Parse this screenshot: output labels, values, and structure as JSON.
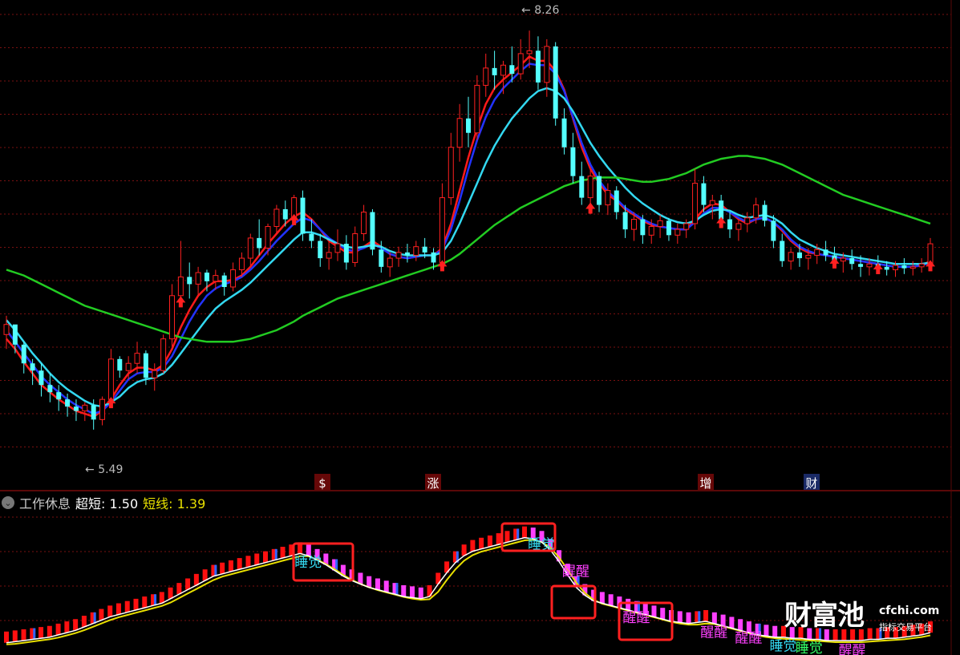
{
  "chart_data": [
    {
      "type": "candlestick",
      "title": "",
      "price_range": [
        5.2,
        8.45
      ],
      "grid": true,
      "annotations": {
        "high_label": "8.26",
        "low_label": "5.49"
      },
      "markers": [
        "$",
        "涨",
        "增",
        "财"
      ],
      "candles": [
        [
          6.15,
          6.28,
          6.05,
          6.22
        ],
        [
          6.22,
          6.2,
          6.02,
          6.08
        ],
        [
          6.08,
          6.1,
          5.88,
          5.95
        ],
        [
          5.95,
          5.98,
          5.8,
          5.9
        ],
        [
          5.9,
          5.95,
          5.72,
          5.8
        ],
        [
          5.8,
          5.88,
          5.68,
          5.75
        ],
        [
          5.75,
          5.8,
          5.62,
          5.7
        ],
        [
          5.7,
          5.74,
          5.58,
          5.65
        ],
        [
          5.65,
          5.7,
          5.55,
          5.62
        ],
        [
          5.62,
          5.68,
          5.55,
          5.66
        ],
        [
          5.66,
          5.7,
          5.49,
          5.56
        ],
        [
          5.56,
          5.72,
          5.52,
          5.7
        ],
        [
          5.7,
          6.05,
          5.65,
          5.98
        ],
        [
          5.98,
          6.0,
          5.85,
          5.9
        ],
        [
          5.9,
          6.0,
          5.84,
          5.95
        ],
        [
          5.95,
          6.1,
          5.88,
          6.02
        ],
        [
          6.02,
          6.04,
          5.8,
          5.85
        ],
        [
          5.85,
          5.95,
          5.76,
          5.9
        ],
        [
          5.9,
          6.15,
          5.88,
          6.12
        ],
        [
          6.12,
          6.5,
          6.05,
          6.42
        ],
        [
          6.42,
          6.8,
          6.35,
          6.55
        ],
        [
          6.55,
          6.65,
          6.4,
          6.5
        ],
        [
          6.5,
          6.62,
          6.42,
          6.58
        ],
        [
          6.58,
          6.6,
          6.45,
          6.52
        ],
        [
          6.52,
          6.6,
          6.46,
          6.56
        ],
        [
          6.56,
          6.58,
          6.42,
          6.48
        ],
        [
          6.48,
          6.65,
          6.45,
          6.6
        ],
        [
          6.6,
          6.72,
          6.55,
          6.68
        ],
        [
          6.68,
          6.85,
          6.62,
          6.82
        ],
        [
          6.82,
          6.95,
          6.7,
          6.75
        ],
        [
          6.75,
          6.92,
          6.7,
          6.9
        ],
        [
          6.9,
          7.05,
          6.85,
          7.02
        ],
        [
          7.02,
          7.08,
          6.9,
          6.95
        ],
        [
          6.95,
          7.12,
          6.92,
          7.1
        ],
        [
          7.1,
          7.15,
          6.8,
          6.85
        ],
        [
          6.85,
          6.95,
          6.75,
          6.8
        ],
        [
          6.8,
          6.85,
          6.62,
          6.68
        ],
        [
          6.68,
          6.8,
          6.6,
          6.72
        ],
        [
          6.72,
          6.88,
          6.66,
          6.78
        ],
        [
          6.78,
          6.84,
          6.6,
          6.65
        ],
        [
          6.65,
          6.9,
          6.62,
          6.85
        ],
        [
          6.85,
          7.05,
          6.8,
          7.0
        ],
        [
          7.0,
          7.02,
          6.7,
          6.74
        ],
        [
          6.74,
          6.8,
          6.58,
          6.62
        ],
        [
          6.62,
          6.72,
          6.55,
          6.68
        ],
        [
          6.68,
          6.76,
          6.62,
          6.72
        ],
        [
          6.72,
          6.78,
          6.65,
          6.7
        ],
        [
          6.7,
          6.8,
          6.66,
          6.76
        ],
        [
          6.76,
          6.82,
          6.68,
          6.72
        ],
        [
          6.72,
          6.75,
          6.6,
          6.65
        ],
        [
          6.65,
          7.2,
          6.6,
          7.1
        ],
        [
          7.1,
          7.55,
          7.05,
          7.45
        ],
        [
          7.45,
          7.75,
          7.35,
          7.65
        ],
        [
          7.65,
          7.8,
          7.45,
          7.55
        ],
        [
          7.55,
          7.95,
          7.5,
          7.88
        ],
        [
          7.88,
          8.1,
          7.8,
          8.0
        ],
        [
          8.0,
          8.12,
          7.85,
          7.95
        ],
        [
          7.95,
          8.05,
          7.82,
          8.02
        ],
        [
          8.02,
          8.15,
          7.9,
          7.96
        ],
        [
          7.96,
          8.2,
          7.92,
          8.1
        ],
        [
          8.1,
          8.26,
          8.0,
          8.12
        ],
        [
          8.12,
          8.22,
          7.85,
          7.9
        ],
        [
          7.9,
          8.2,
          7.8,
          8.15
        ],
        [
          8.15,
          8.18,
          7.6,
          7.65
        ],
        [
          7.65,
          7.72,
          7.4,
          7.45
        ],
        [
          7.45,
          7.55,
          7.2,
          7.25
        ],
        [
          7.25,
          7.35,
          7.05,
          7.1
        ],
        [
          7.1,
          7.3,
          7.0,
          7.25
        ],
        [
          7.25,
          7.28,
          7.0,
          7.05
        ],
        [
          7.05,
          7.2,
          6.98,
          7.15
        ],
        [
          7.15,
          7.18,
          6.95,
          7.0
        ],
        [
          7.0,
          7.05,
          6.82,
          6.88
        ],
        [
          6.88,
          7.0,
          6.8,
          6.95
        ],
        [
          6.95,
          6.98,
          6.78,
          6.84
        ],
        [
          6.84,
          6.95,
          6.78,
          6.9
        ],
        [
          6.9,
          6.98,
          6.82,
          6.94
        ],
        [
          6.94,
          6.96,
          6.8,
          6.84
        ],
        [
          6.84,
          6.92,
          6.78,
          6.88
        ],
        [
          6.88,
          6.95,
          6.82,
          6.92
        ],
        [
          6.92,
          7.3,
          6.88,
          7.2
        ],
        [
          7.2,
          7.25,
          7.0,
          7.05
        ],
        [
          7.05,
          7.12,
          6.95,
          7.08
        ],
        [
          7.08,
          7.12,
          6.9,
          6.95
        ],
        [
          6.95,
          7.0,
          6.82,
          6.88
        ],
        [
          6.88,
          6.95,
          6.8,
          6.92
        ],
        [
          6.92,
          7.0,
          6.86,
          6.96
        ],
        [
          6.96,
          7.1,
          6.92,
          7.05
        ],
        [
          7.05,
          7.08,
          6.9,
          6.94
        ],
        [
          6.94,
          6.98,
          6.75,
          6.8
        ],
        [
          6.8,
          6.85,
          6.62,
          6.66
        ],
        [
          6.66,
          6.75,
          6.6,
          6.72
        ],
        [
          6.72,
          6.78,
          6.62,
          6.68
        ],
        [
          6.68,
          6.75,
          6.6,
          6.7
        ],
        [
          6.7,
          6.78,
          6.64,
          6.74
        ],
        [
          6.74,
          6.8,
          6.66,
          6.7
        ],
        [
          6.7,
          6.76,
          6.62,
          6.66
        ],
        [
          6.66,
          6.72,
          6.58,
          6.68
        ],
        [
          6.68,
          6.74,
          6.6,
          6.64
        ],
        [
          6.64,
          6.7,
          6.55,
          6.62
        ],
        [
          6.62,
          6.68,
          6.56,
          6.64
        ],
        [
          6.64,
          6.7,
          6.58,
          6.62
        ],
        [
          6.62,
          6.66,
          6.56,
          6.6
        ],
        [
          6.6,
          6.66,
          6.55,
          6.63
        ],
        [
          6.63,
          6.68,
          6.57,
          6.61
        ],
        [
          6.61,
          6.66,
          6.56,
          6.62
        ],
        [
          6.62,
          6.68,
          6.58,
          6.64
        ],
        [
          6.64,
          6.82,
          6.6,
          6.78
        ]
      ],
      "series": [
        {
          "color": "#ff1a1a",
          "values": [
            6.12,
            6.05,
            5.96,
            5.88,
            5.8,
            5.75,
            5.7,
            5.66,
            5.62,
            5.6,
            5.58,
            5.62,
            5.7,
            5.8,
            5.88,
            5.92,
            5.92,
            5.9,
            5.94,
            6.05,
            6.2,
            6.32,
            6.42,
            6.48,
            6.52,
            6.52,
            6.53,
            6.56,
            6.62,
            6.7,
            6.78,
            6.85,
            6.92,
            6.97,
            7.0,
            6.95,
            6.88,
            6.8,
            6.76,
            6.72,
            6.72,
            6.76,
            6.8,
            6.76,
            6.71,
            6.69,
            6.68,
            6.69,
            6.7,
            6.7,
            6.75,
            6.92,
            7.15,
            7.38,
            7.58,
            7.75,
            7.86,
            7.92,
            7.97,
            8.02,
            8.08,
            8.05,
            8.05,
            7.98,
            7.85,
            7.65,
            7.45,
            7.3,
            7.2,
            7.12,
            7.08,
            7.02,
            6.98,
            6.94,
            6.91,
            6.9,
            6.89,
            6.88,
            6.88,
            6.95,
            7.02,
            7.06,
            7.05,
            7.0,
            6.95,
            6.92,
            6.95,
            6.96,
            6.93,
            6.87,
            6.8,
            6.75,
            6.72,
            6.71,
            6.7,
            6.69,
            6.68,
            6.67,
            6.66,
            6.65,
            6.64,
            6.63,
            6.62,
            6.62,
            6.62,
            6.63,
            6.66
          ]
        },
        {
          "color": "#2233ff",
          "values": [
            6.18,
            6.1,
            6.02,
            5.94,
            5.86,
            5.8,
            5.75,
            5.7,
            5.66,
            5.63,
            5.6,
            5.62,
            5.68,
            5.76,
            5.84,
            5.88,
            5.89,
            5.89,
            5.92,
            6.0,
            6.12,
            6.24,
            6.34,
            6.42,
            6.47,
            6.5,
            6.52,
            6.55,
            6.6,
            6.66,
            6.73,
            6.8,
            6.86,
            6.92,
            6.96,
            6.94,
            6.88,
            6.82,
            6.78,
            6.74,
            6.73,
            6.75,
            6.78,
            6.75,
            6.71,
            6.69,
            6.68,
            6.69,
            6.7,
            6.7,
            6.74,
            6.88,
            7.08,
            7.3,
            7.5,
            7.66,
            7.78,
            7.86,
            7.92,
            7.98,
            8.03,
            8.02,
            8.02,
            7.96,
            7.84,
            7.66,
            7.48,
            7.33,
            7.22,
            7.14,
            7.09,
            7.03,
            6.99,
            6.95,
            6.92,
            6.9,
            6.89,
            6.88,
            6.88,
            6.93,
            6.99,
            7.03,
            7.03,
            7.0,
            6.96,
            6.93,
            6.95,
            6.96,
            6.93,
            6.88,
            6.81,
            6.76,
            6.73,
            6.71,
            6.7,
            6.69,
            6.68,
            6.67,
            6.66,
            6.65,
            6.64,
            6.63,
            6.62,
            6.62,
            6.62,
            6.63,
            6.65
          ]
        },
        {
          "color": "#33d8f0",
          "values": [
            6.25,
            6.18,
            6.1,
            6.02,
            5.95,
            5.88,
            5.82,
            5.77,
            5.73,
            5.69,
            5.66,
            5.65,
            5.68,
            5.72,
            5.78,
            5.82,
            5.84,
            5.85,
            5.88,
            5.94,
            6.02,
            6.1,
            6.18,
            6.26,
            6.33,
            6.38,
            6.42,
            6.46,
            6.51,
            6.57,
            6.63,
            6.69,
            6.75,
            6.81,
            6.86,
            6.86,
            6.84,
            6.81,
            6.78,
            6.76,
            6.75,
            6.76,
            6.77,
            6.76,
            6.73,
            6.71,
            6.7,
            6.7,
            6.7,
            6.7,
            6.72,
            6.8,
            6.92,
            7.06,
            7.2,
            7.34,
            7.46,
            7.56,
            7.65,
            7.72,
            7.79,
            7.84,
            7.86,
            7.84,
            7.79,
            7.7,
            7.59,
            7.48,
            7.39,
            7.31,
            7.24,
            7.17,
            7.11,
            7.06,
            7.02,
            6.98,
            6.95,
            6.93,
            6.92,
            6.94,
            6.98,
            7.01,
            7.02,
            7.01,
            6.98,
            6.96,
            6.97,
            6.98,
            6.96,
            6.92,
            6.86,
            6.81,
            6.78,
            6.75,
            6.73,
            6.71,
            6.7,
            6.69,
            6.68,
            6.67,
            6.66,
            6.65,
            6.64,
            6.64,
            6.64,
            6.64,
            6.65
          ]
        },
        {
          "color": "#22cc22",
          "values": [
            6.6,
            6.58,
            6.56,
            6.53,
            6.5,
            6.47,
            6.44,
            6.41,
            6.38,
            6.35,
            6.33,
            6.31,
            6.29,
            6.27,
            6.25,
            6.23,
            6.21,
            6.19,
            6.17,
            6.15,
            6.13,
            6.12,
            6.11,
            6.1,
            6.1,
            6.1,
            6.1,
            6.11,
            6.12,
            6.14,
            6.16,
            6.18,
            6.21,
            6.24,
            6.28,
            6.31,
            6.34,
            6.37,
            6.4,
            6.42,
            6.44,
            6.46,
            6.48,
            6.5,
            6.52,
            6.54,
            6.56,
            6.58,
            6.6,
            6.62,
            6.64,
            6.67,
            6.71,
            6.76,
            6.81,
            6.86,
            6.91,
            6.95,
            6.99,
            7.03,
            7.06,
            7.09,
            7.12,
            7.15,
            7.18,
            7.2,
            7.22,
            7.23,
            7.24,
            7.24,
            7.24,
            7.23,
            7.22,
            7.21,
            7.21,
            7.22,
            7.23,
            7.25,
            7.27,
            7.3,
            7.33,
            7.35,
            7.37,
            7.38,
            7.39,
            7.39,
            7.38,
            7.37,
            7.35,
            7.33,
            7.3,
            7.27,
            7.24,
            7.21,
            7.18,
            7.15,
            7.12,
            7.1,
            7.08,
            7.06,
            7.04,
            7.02,
            7.0,
            6.98,
            6.96,
            6.94,
            6.92
          ]
        }
      ],
      "signal_arrows": [
        12,
        20,
        33,
        50,
        67,
        82,
        95,
        100,
        106
      ]
    },
    {
      "type": "line",
      "title": "工作休息",
      "y_range": [
        0,
        100
      ],
      "series": [
        {
          "name": "超短",
          "color": "#ffffff",
          "value_label": "1.50"
        },
        {
          "name": "短线",
          "color": "#e8e000",
          "value_label": "1.39"
        }
      ],
      "values": [
        3,
        4,
        5,
        6,
        7,
        8,
        10,
        12,
        14,
        17,
        20,
        23,
        26,
        28,
        30,
        32,
        34,
        36,
        38,
        42,
        46,
        50,
        54,
        58,
        62,
        64,
        66,
        68,
        70,
        72,
        74,
        76,
        78,
        80,
        82,
        80,
        76,
        72,
        67,
        62,
        58,
        55,
        52,
        50,
        48,
        46,
        44,
        43,
        42,
        44,
        55,
        65,
        74,
        80,
        84,
        86,
        88,
        90,
        92,
        94,
        96,
        95,
        92,
        85,
        75,
        63,
        52,
        45,
        40,
        38,
        36,
        34,
        32,
        30,
        28,
        26,
        24,
        22,
        21,
        20,
        21,
        22,
        20,
        18,
        16,
        14,
        12,
        10,
        9,
        8,
        8,
        7,
        7,
        6,
        6,
        5,
        5,
        5,
        5,
        5,
        6,
        6,
        7,
        7,
        8,
        9,
        10,
        12
      ],
      "labels": [
        "睡觉",
        "睡觉",
        "醒醒",
        "醒醒",
        "醒醒",
        "醒醒",
        "睡觉",
        "睡觉",
        "醒醒"
      ]
    }
  ],
  "legend": {
    "name": "工作休息",
    "items": [
      {
        "label": "超短",
        "value": "1.50"
      },
      {
        "label": "短线",
        "value": "1.39"
      }
    ]
  },
  "watermark": {
    "brand": "财富池",
    "url": "cfchi.com",
    "sub": "指标交易平台"
  },
  "colors": {
    "up": "#ff2020",
    "down": "#54ffff",
    "ma_red": "#ff1a1a",
    "ma_blue": "#2233ff",
    "ma_cyan": "#33d8f0",
    "ma_green": "#22cc22",
    "grid": "#7a1010"
  }
}
